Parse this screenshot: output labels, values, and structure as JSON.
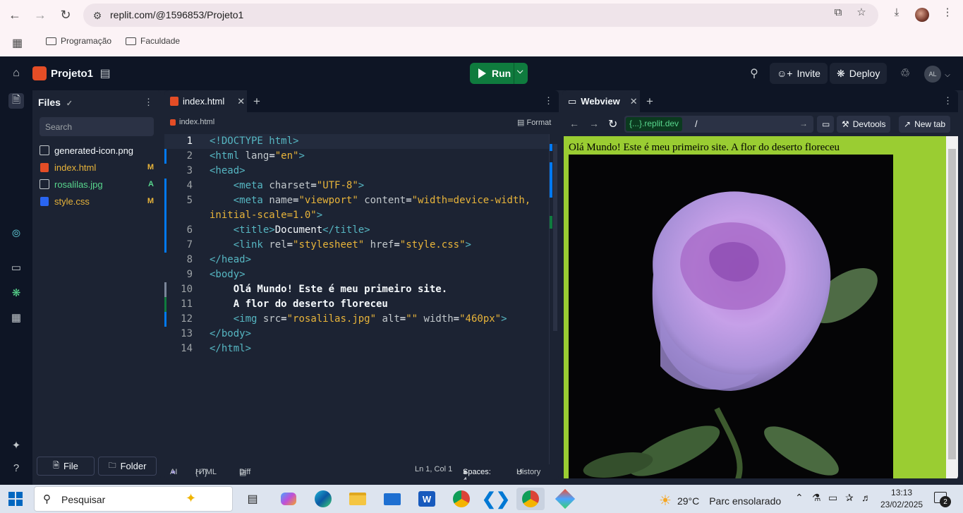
{
  "browser": {
    "url": "replit.com/@1596853/Projeto1",
    "bookmarks": [
      "Programação",
      "Faculdade"
    ]
  },
  "topbar": {
    "project_name": "Projeto1",
    "run_label": "Run",
    "invite_label": "Invite",
    "deploy_label": "Deploy",
    "avatar_initials": "AL"
  },
  "files": {
    "title": "Files",
    "search_placeholder": "Search",
    "items": [
      {
        "name": "generated-icon.png",
        "badge": "",
        "color": "#f5f9fc"
      },
      {
        "name": "index.html",
        "badge": "M",
        "color": "#e8b43a"
      },
      {
        "name": "rosalilas.jpg",
        "badge": "A",
        "color": "#58d68d"
      },
      {
        "name": "style.css",
        "badge": "M",
        "color": "#e8b43a"
      }
    ],
    "new_file_label": "File",
    "new_folder_label": "Folder"
  },
  "editor": {
    "tab_label": "index.html",
    "breadcrumb": "index.html",
    "format_label": "Format",
    "line_numbers": [
      "1",
      "2",
      "3",
      "4",
      "5",
      "",
      "6",
      "7",
      "8",
      "9",
      "10",
      "11",
      "12",
      "13",
      "14"
    ],
    "status": {
      "ai": "AI",
      "lang": "HTML",
      "diff": "Diff",
      "position": "Ln 1, Col 1",
      "spaces": "Spaces: 4",
      "history": "History"
    }
  },
  "webview": {
    "tab_label": "Webview",
    "host": "{...}.replit.dev",
    "path": "/",
    "devtools_label": "Devtools",
    "newtab_label": "New tab",
    "page_text": "Olá Mundo! Este é meu primeiro site. A flor do deserto floreceu"
  },
  "taskbar": {
    "search_label": "Pesquisar",
    "weather_temp": "29°C",
    "weather_text": "Parc ensolarado",
    "time": "13:13",
    "date": "23/02/2025",
    "notification_count": "2"
  }
}
